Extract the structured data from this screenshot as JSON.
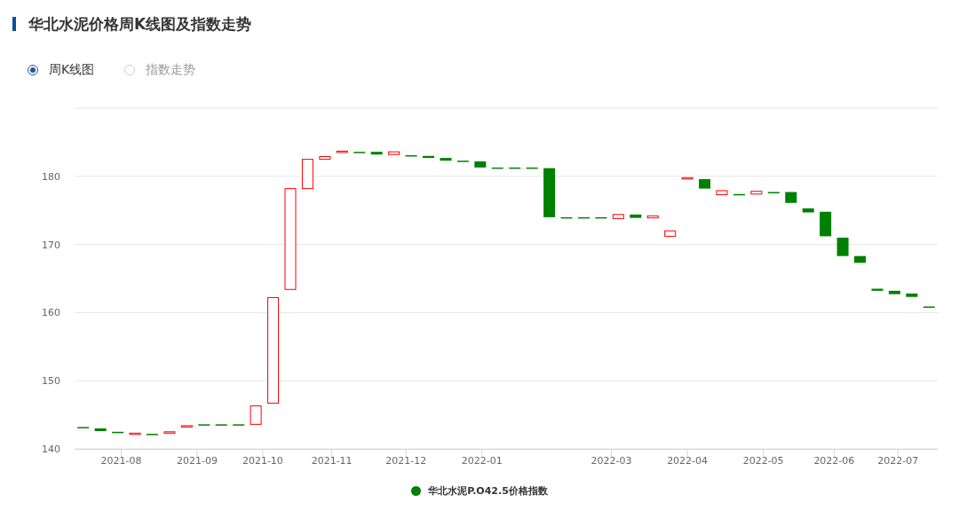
{
  "title": "华北水泥价格周K线图及指数走势",
  "view_options": [
    {
      "label": "周K线图",
      "selected": true
    },
    {
      "label": "指数走势",
      "selected": false
    }
  ],
  "chart": {
    "y_axis_labels": [
      "180",
      "170",
      "160",
      "150",
      "140"
    ],
    "x_axis_labels": [
      "2021-08",
      "2021-09",
      "2021-10",
      "2021-11",
      "2021-12",
      "2022-01",
      "2022-03",
      "2022-04",
      "2022-05",
      "2022-06",
      "2022-07"
    ],
    "legend": {
      "label": "华北水泥P.O42.5价格指数",
      "color": "#008000"
    }
  }
}
